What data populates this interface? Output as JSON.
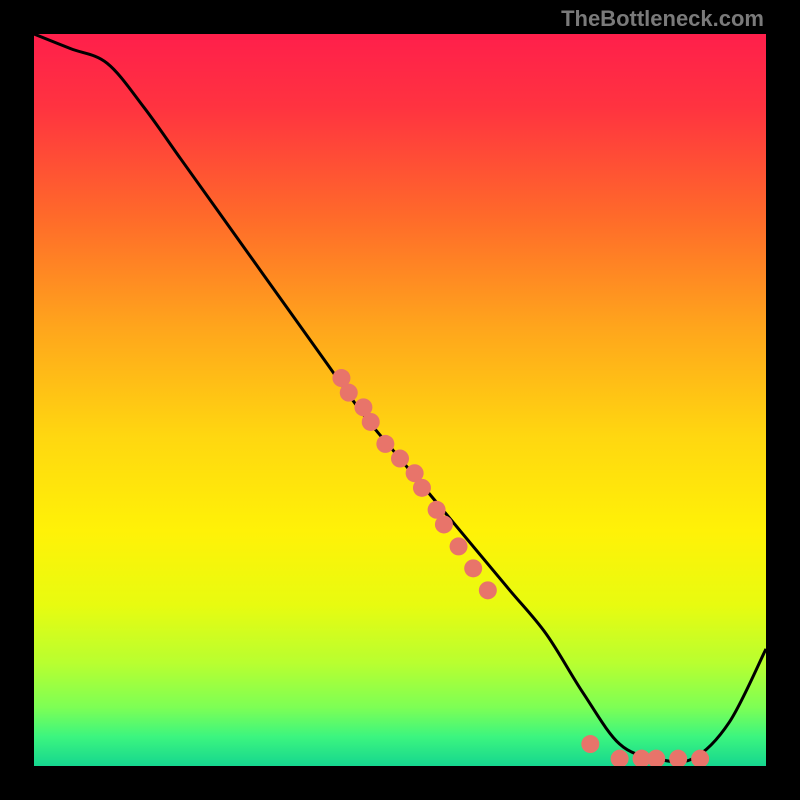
{
  "watermark": "TheBottleneck.com",
  "chart_data": {
    "type": "line",
    "title": "",
    "xlabel": "",
    "ylabel": "",
    "xlim": [
      0,
      100
    ],
    "ylim": [
      0,
      100
    ],
    "grid": false,
    "background": "rainbow-vertical-gradient",
    "series": [
      {
        "name": "curve",
        "color": "#000000",
        "x": [
          0,
          5,
          10,
          15,
          20,
          25,
          30,
          35,
          40,
          45,
          50,
          55,
          60,
          65,
          70,
          75,
          80,
          85,
          90,
          95,
          100
        ],
        "y": [
          100,
          98,
          96,
          90,
          83,
          76,
          69,
          62,
          55,
          48,
          42,
          36,
          30,
          24,
          18,
          10,
          3,
          1,
          1,
          6,
          16
        ]
      }
    ],
    "points": {
      "name": "dots",
      "color": "#e8746a",
      "radius": 9,
      "x": [
        42,
        43,
        45,
        46,
        48,
        50,
        52,
        53,
        55,
        56,
        58,
        60,
        62,
        76,
        80,
        83,
        85,
        88,
        91
      ],
      "y": [
        53,
        51,
        49,
        47,
        44,
        42,
        40,
        38,
        35,
        33,
        30,
        27,
        24,
        3,
        1,
        1,
        1,
        1,
        1
      ]
    },
    "gradient_stops": [
      {
        "offset": 0.0,
        "color": "#ff1f4b"
      },
      {
        "offset": 0.1,
        "color": "#ff3340"
      },
      {
        "offset": 0.25,
        "color": "#ff6a2a"
      },
      {
        "offset": 0.4,
        "color": "#ffa51c"
      },
      {
        "offset": 0.55,
        "color": "#ffd710"
      },
      {
        "offset": 0.68,
        "color": "#fff207"
      },
      {
        "offset": 0.78,
        "color": "#e8fb10"
      },
      {
        "offset": 0.86,
        "color": "#b8ff30"
      },
      {
        "offset": 0.92,
        "color": "#7dff55"
      },
      {
        "offset": 0.96,
        "color": "#3cf57f"
      },
      {
        "offset": 1.0,
        "color": "#15d68f"
      }
    ]
  }
}
